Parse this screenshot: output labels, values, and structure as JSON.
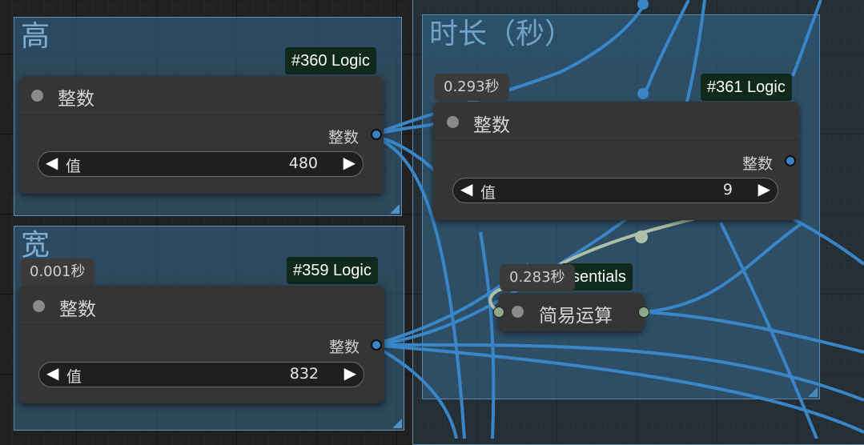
{
  "colors": {
    "wire": "#3a85c6",
    "group": "#3a6e96",
    "badge": "#0f2a1c",
    "node": "#353535",
    "port_int": "#3b82c8",
    "port_generic": "#8fa88a"
  },
  "groups": {
    "height_group": "高",
    "width_group": "宽",
    "duration_group": "时长（秒）"
  },
  "nodes": {
    "n360": {
      "badge": "#360 Logic",
      "title": "整数",
      "output": "整数",
      "widget_label": "值",
      "widget_value": "480"
    },
    "n359": {
      "timer": "0.001秒",
      "badge": "#359 Logic",
      "title": "整数",
      "output": "整数",
      "widget_label": "值",
      "widget_value": "832"
    },
    "n361": {
      "timer": "0.293秒",
      "badge": "#361 Logic",
      "title": "整数",
      "output": "整数",
      "widget_label": "值",
      "widget_value": "9"
    },
    "simple_math": {
      "timer": "0.283秒",
      "badge": "sentials",
      "title": "简易运算"
    }
  },
  "icons": {
    "decrement": "◀",
    "increment": "▶"
  }
}
